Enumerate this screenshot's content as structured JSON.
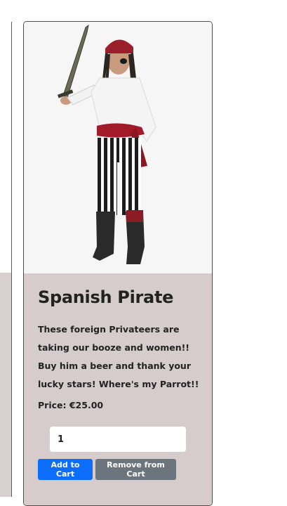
{
  "product": {
    "title": "Spanish Pirate",
    "description": "These foreign Privateers are taking our booze and women!! Buy him a beer and thank your lucky stars! Where's my Parrot!!",
    "price": "Price: €25.00",
    "quantity_value": "1",
    "image_icon": "pirate-costume-image"
  },
  "actions": {
    "add_label": "Add to Cart",
    "remove_label": "Remove from Cart"
  },
  "colors": {
    "card_body": "#d6cccc",
    "add_button": "#0d6efd",
    "remove_button": "#6c757d"
  }
}
